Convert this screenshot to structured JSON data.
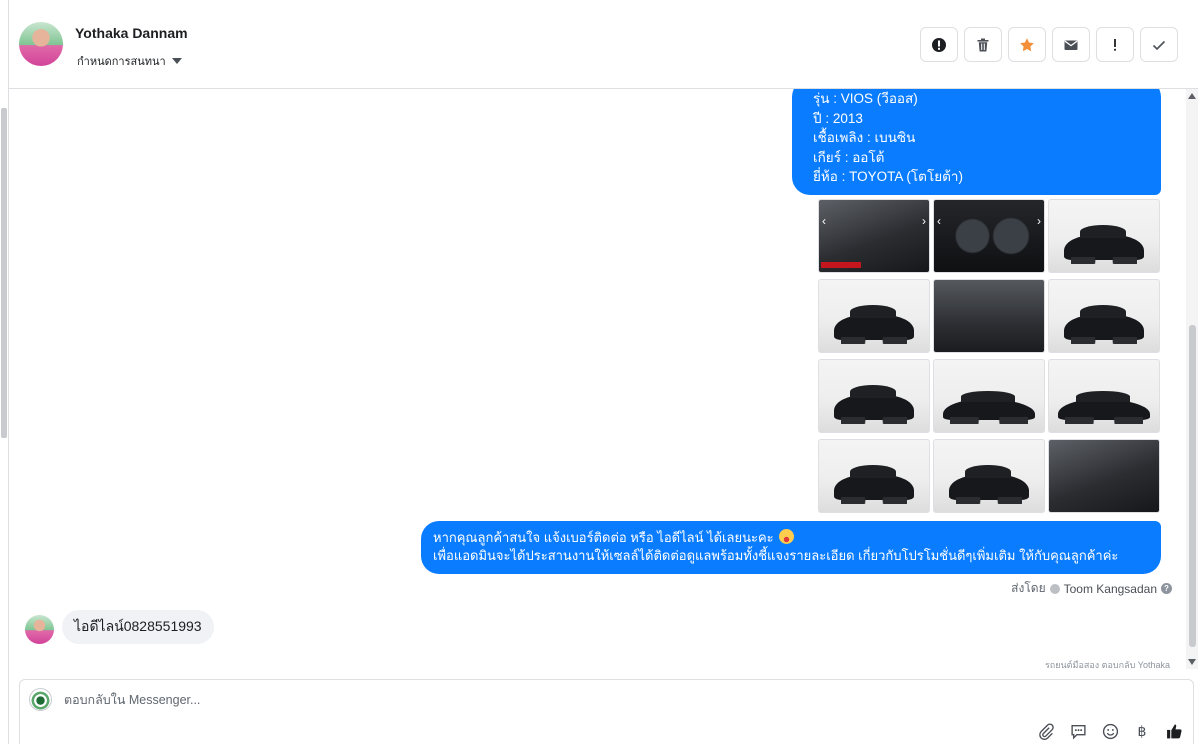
{
  "header": {
    "contact_name": "Yothaka Dannam",
    "stage_label": "กำหนดการสนทนา",
    "actions": [
      {
        "icon": "alert-circle-icon",
        "name": "mark-spam-button"
      },
      {
        "icon": "trash-icon",
        "name": "delete-button"
      },
      {
        "icon": "star-icon",
        "name": "star-button"
      },
      {
        "icon": "envelope-icon",
        "name": "mark-unread-button"
      },
      {
        "icon": "exclamation-icon",
        "name": "follow-up-button"
      },
      {
        "icon": "checkmark-icon",
        "name": "mark-done-button"
      }
    ]
  },
  "messages": {
    "car_spec_lines": [
      "รุ่น : VIOS (วีออส)",
      "ปี : 2013",
      "เชื้อเพลิง : เบนซิน",
      "เกียร์ : ออโต้",
      "ยี่ห้อ : TOYOTA (โตโยต้า)"
    ],
    "photos": [
      {
        "scene": "interior"
      },
      {
        "scene": "gauge"
      },
      {
        "scene": "front-three-quarter"
      },
      {
        "scene": "rear-three-quarter"
      },
      {
        "scene": "seats"
      },
      {
        "scene": "front"
      },
      {
        "scene": "rear"
      },
      {
        "scene": "side"
      },
      {
        "scene": "side-alt"
      },
      {
        "scene": "front-angle"
      },
      {
        "scene": "rear-angle"
      },
      {
        "scene": "dashboard"
      }
    ],
    "promo_line1": "หากคุณลูกค้าสนใจ แจ้งเบอร์ติดต่อ หรือ ไอดีไลน์ ได้เลยนะคะ",
    "promo_line2": "เพื่อแอดมินจะได้ประสานงานให้เซลล์ได้ติดต่อดูแลพร้อมทั้งชี้แจงรายละเอียด เกี่ยวกับโปรโมชั่นดีๆเพิ่มเติม ให้กับคุณลูกค้าค่ะ",
    "promo_emoji": "heart-eyes-emoji",
    "sent_by_label": "ส่งโดย",
    "sender_name": "Toom Kangsadan",
    "incoming_text": "ไอดีไลน์0828551993",
    "reply_note": "รถยนต์มือสอง ตอบกลับ Yothaka"
  },
  "composer": {
    "placeholder": "ตอบกลับใน Messenger...",
    "tools": [
      "paperclip-icon",
      "saved-replies-icon",
      "emoji-icon",
      "baht-icon",
      "thumbs-up-icon"
    ]
  },
  "colors": {
    "outgoing_bubble": "#0a7cff",
    "incoming_bubble": "#f0f2f5",
    "star": "#f28f38"
  }
}
